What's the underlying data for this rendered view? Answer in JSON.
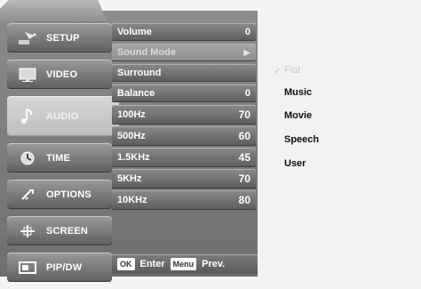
{
  "nav": {
    "items": [
      {
        "label": "SETUP",
        "icon": "satellite-dish-icon"
      },
      {
        "label": "VIDEO",
        "icon": "display-icon"
      },
      {
        "label": "AUDIO",
        "icon": "music-note-icon"
      },
      {
        "label": "TIME",
        "icon": "clock-icon"
      },
      {
        "label": "OPTIONS",
        "icon": "tools-icon"
      },
      {
        "label": "SCREEN",
        "icon": "screen-adjust-icon"
      },
      {
        "label": "PIP/DW",
        "icon": "pip-icon"
      }
    ]
  },
  "audio_menu": {
    "volume": {
      "label": "Volume",
      "value": "0"
    },
    "sound_mode": {
      "label": "Sound Mode"
    },
    "surround": {
      "label": "Surround"
    },
    "balance": {
      "label": "Balance",
      "value": "0"
    },
    "equalizer": [
      {
        "label": "100Hz",
        "value": "70"
      },
      {
        "label": "500Hz",
        "value": "60"
      },
      {
        "label": "1.5KHz",
        "value": "45"
      },
      {
        "label": "5KHz",
        "value": "70"
      },
      {
        "label": "10KHz",
        "value": "80"
      }
    ]
  },
  "help": {
    "ok_key": "OK",
    "enter_label": "Enter",
    "menu_key": "Menu",
    "prev_label": "Prev."
  },
  "sound_mode_options": {
    "flat": "Flat",
    "music": "Music",
    "movie": "Movie",
    "speech": "Speech",
    "user": "User"
  },
  "colors": {
    "panel": "#6e6e6e",
    "selected": "#bdbdbd",
    "text": "#ffffff",
    "disabled": "#c9c9c9"
  }
}
